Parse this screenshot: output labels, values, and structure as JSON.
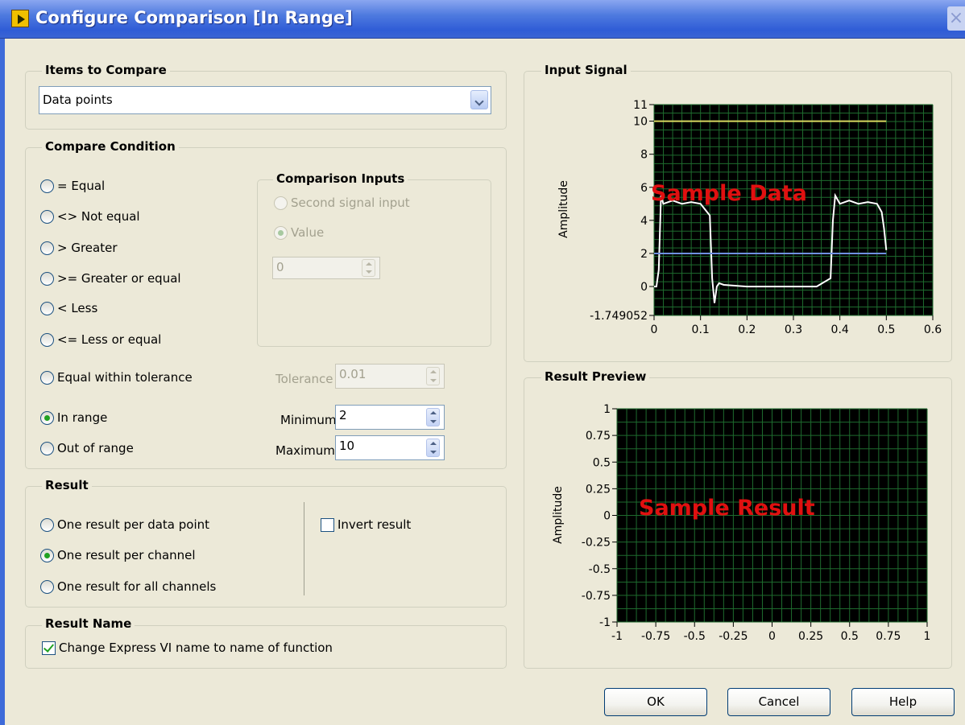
{
  "window": {
    "title": "Configure Comparison [In Range]",
    "close_glyph": "×"
  },
  "items_to_compare": {
    "label": "Items to Compare",
    "value": "Data points"
  },
  "compare_condition": {
    "label": "Compare Condition",
    "options": {
      "equal": "= Equal",
      "not_equal": "<> Not equal",
      "greater": "> Greater",
      "greater_or_equal": ">= Greater or equal",
      "less": "< Less",
      "less_or_equal": "<= Less or equal",
      "equal_within_tolerance": "Equal within tolerance",
      "in_range": "In range",
      "out_of_range": "Out of range"
    },
    "selected": "In range"
  },
  "comparison_inputs": {
    "label": "Comparison Inputs",
    "second_signal_label": "Second signal input",
    "value_label": "Value",
    "value": "0"
  },
  "tolerance": {
    "label": "Tolerance",
    "value": "0.01"
  },
  "minimum": {
    "label": "Minimum",
    "value": "2"
  },
  "maximum": {
    "label": "Maximum",
    "value": "10"
  },
  "result": {
    "label": "Result",
    "per_data_point": "One result per data point",
    "per_channel": "One result per channel",
    "all_channels": "One result for all channels",
    "invert": "Invert result",
    "selected": "One result per channel"
  },
  "result_name": {
    "label": "Result Name",
    "checkbox": "Change Express VI name to name of function",
    "checked": true
  },
  "buttons": {
    "ok": "OK",
    "cancel": "Cancel",
    "help": "Help"
  },
  "input_signal": {
    "label": "Input Signal",
    "ylabel": "Amplitude",
    "overlay": "Sample Data",
    "y_ticks": [
      "11",
      "10",
      "8",
      "6",
      "4",
      "2",
      "0",
      "-1.749052"
    ],
    "x_ticks": [
      "0",
      "0.1",
      "0.2",
      "0.3",
      "0.4",
      "0.5",
      "0.6"
    ]
  },
  "result_preview": {
    "label": "Result Preview",
    "ylabel": "Amplitude",
    "overlay": "Sample Result",
    "y_ticks": [
      "1",
      "0.75",
      "0.5",
      "0.25",
      "0",
      "-0.25",
      "-0.5",
      "-0.75",
      "-1"
    ],
    "x_ticks": [
      "-1",
      "-0.75",
      "-0.5",
      "-0.25",
      "0",
      "0.25",
      "0.5",
      "0.75",
      "1"
    ]
  },
  "chart_data": [
    {
      "type": "line",
      "title": "Input Signal",
      "ylabel": "Amplitude",
      "xlim": [
        0,
        0.6
      ],
      "ylim": [
        -1.749052,
        11
      ],
      "grid": true,
      "series": [
        {
          "x": [
            0,
            0.005,
            0.01,
            0.015,
            0.02,
            0.04,
            0.06,
            0.08,
            0.1,
            0.12,
            0.125,
            0.13,
            0.135,
            0.14,
            0.15,
            0.2,
            0.25,
            0.3,
            0.35,
            0.38,
            0.385,
            0.39,
            0.4,
            0.42,
            0.44,
            0.46,
            0.48,
            0.49,
            0.495,
            0.5
          ],
          "y": [
            0,
            0,
            1,
            5.5,
            5,
            5.2,
            5,
            5.1,
            5,
            4.3,
            0.5,
            -1,
            0,
            0.2,
            0.1,
            0,
            0,
            0,
            0,
            0.5,
            4,
            5.5,
            5,
            5.2,
            5,
            5.1,
            5,
            4.5,
            3.5,
            2.2
          ],
          "color": "#ffffff"
        },
        {
          "x": [
            0,
            0.5
          ],
          "y": [
            10,
            10
          ],
          "color": "#d8d860"
        },
        {
          "x": [
            0,
            0.5
          ],
          "y": [
            2,
            2
          ],
          "color": "#6f8fe0"
        }
      ]
    },
    {
      "type": "line",
      "title": "Result Preview",
      "ylabel": "Amplitude",
      "xlim": [
        -1,
        1
      ],
      "ylim": [
        -1,
        1
      ],
      "grid": true,
      "series": []
    }
  ]
}
